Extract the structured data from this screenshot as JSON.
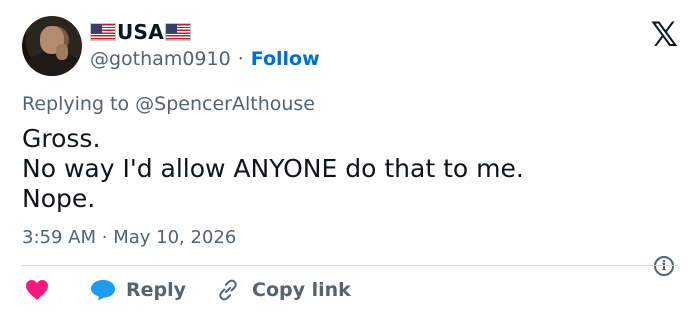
{
  "author": {
    "display_name": "USA",
    "handle": "@gotham0910",
    "follow_label": "Follow",
    "separator": "·"
  },
  "reply_context": {
    "prefix": "Replying to",
    "mention": "@SpencerAlthouse"
  },
  "tweet": {
    "lines": [
      "Gross.",
      "No way I'd allow ANYONE do that to me.",
      "Nope."
    ],
    "time": "3:59 AM",
    "separator": "·",
    "date": "May 10, 2026"
  },
  "actions": {
    "reply_label": "Reply",
    "copy_link_label": "Copy link"
  },
  "icons": {
    "brand": "x-logo-icon",
    "info": "info-icon",
    "like": "heart-icon",
    "reply": "reply-bubble-icon",
    "copy": "link-icon"
  },
  "colors": {
    "text": "#0f1419",
    "secondary": "#536471",
    "follow": "#006fd6",
    "heart": "#f91880",
    "reply": "#1d9bf0"
  }
}
